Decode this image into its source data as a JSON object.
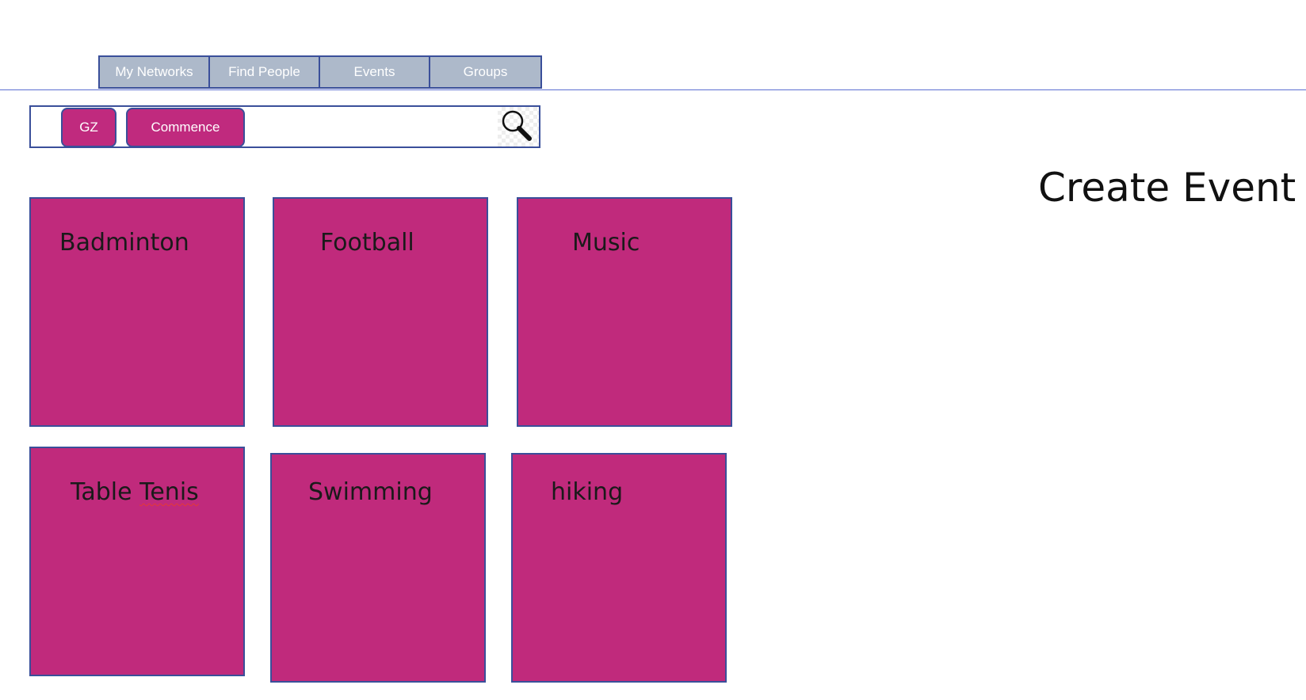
{
  "nav": {
    "tabs": [
      {
        "label": "My Networks"
      },
      {
        "label": "Find People"
      },
      {
        "label": "Events"
      },
      {
        "label": "Groups"
      }
    ]
  },
  "search": {
    "chips": [
      {
        "label": "GZ"
      },
      {
        "label": "Commence"
      }
    ],
    "value": "",
    "icon": "magnifier-icon"
  },
  "create_event": {
    "label": "Create Event"
  },
  "events": {
    "tiles": [
      {
        "label_prefix": "Badminton",
        "label_flagged": ""
      },
      {
        "label_prefix": "Football",
        "label_flagged": ""
      },
      {
        "label_prefix": "Music",
        "label_flagged": ""
      },
      {
        "label_prefix": "Table ",
        "label_flagged": "Tenis"
      },
      {
        "label_prefix": "Swimming",
        "label_flagged": ""
      },
      {
        "label_prefix": "hiking",
        "label_flagged": ""
      }
    ]
  },
  "colors": {
    "tile": "#c02a7c",
    "tab": "#adb9ca",
    "border": "#3a4f9a",
    "divider": "#5b6fd1"
  }
}
